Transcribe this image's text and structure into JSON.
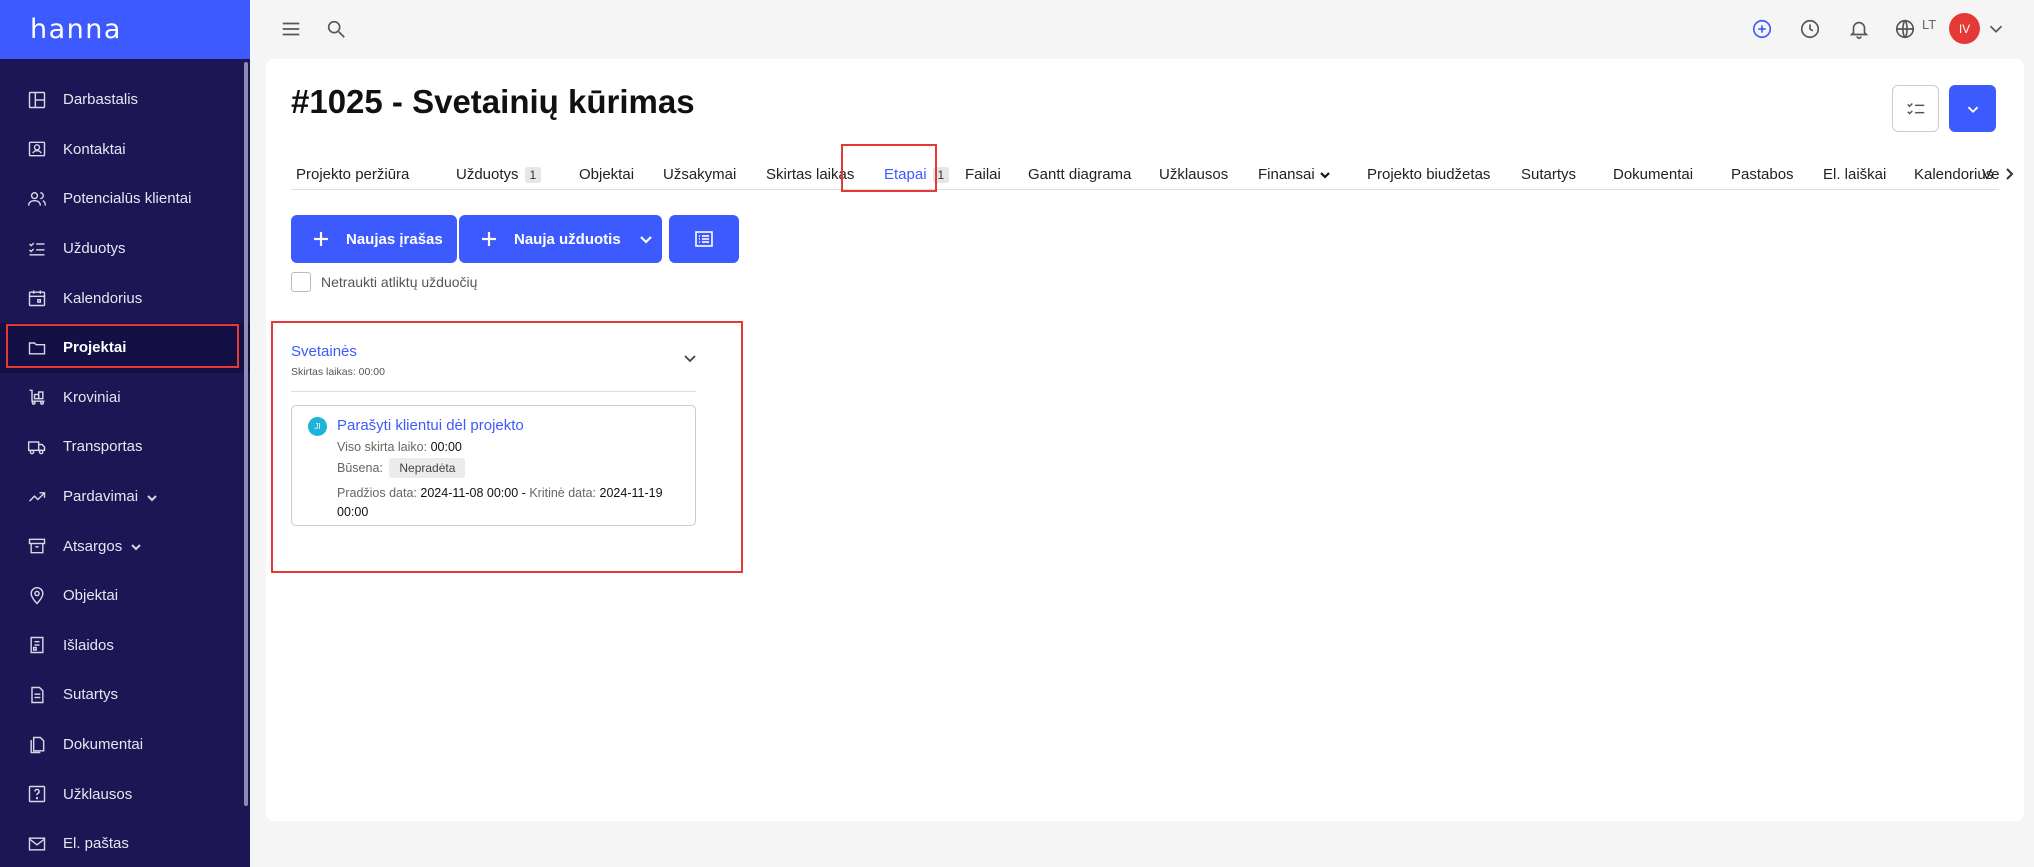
{
  "logo": "hanna",
  "sidebar": {
    "items": [
      {
        "label": "Darbastalis",
        "icon": "dashboard-icon"
      },
      {
        "label": "Kontaktai",
        "icon": "contacts-icon"
      },
      {
        "label": "Potencialūs klientai",
        "icon": "leads-icon"
      },
      {
        "label": "Užduotys",
        "icon": "tasks-icon"
      },
      {
        "label": "Kalendorius",
        "icon": "calendar-icon"
      },
      {
        "label": "Projektai",
        "icon": "folder-icon"
      },
      {
        "label": "Kroviniai",
        "icon": "cargo-icon"
      },
      {
        "label": "Transportas",
        "icon": "truck-icon"
      },
      {
        "label": "Pardavimai",
        "icon": "trending-icon"
      },
      {
        "label": "Atsargos",
        "icon": "archive-icon"
      },
      {
        "label": "Objektai",
        "icon": "location-icon"
      },
      {
        "label": "Išlaidos",
        "icon": "receipt-icon"
      },
      {
        "label": "Sutartys",
        "icon": "contract-icon"
      },
      {
        "label": "Dokumentai",
        "icon": "documents-icon"
      },
      {
        "label": "Užklausos",
        "icon": "question-icon"
      },
      {
        "label": "El. paštas",
        "icon": "mail-icon"
      }
    ],
    "active": "Projektai"
  },
  "topbar": {
    "language": "LT",
    "user_initials": "IV"
  },
  "page": {
    "title": "#1025 - Svetainių kūrimas"
  },
  "tabs": [
    {
      "label": "Projekto peržiūra"
    },
    {
      "label": "Užduotys",
      "badge": "1"
    },
    {
      "label": "Objektai"
    },
    {
      "label": "Užsakymai"
    },
    {
      "label": "Skirtas laikas"
    },
    {
      "label": "Etapai",
      "badge": "1",
      "active": true
    },
    {
      "label": "Failai"
    },
    {
      "label": "Gantt diagrama"
    },
    {
      "label": "Užklausos"
    },
    {
      "label": "Finansai"
    },
    {
      "label": "Projekto biudžetas"
    },
    {
      "label": "Sutartys"
    },
    {
      "label": "Dokumentai"
    },
    {
      "label": "Pastabos"
    },
    {
      "label": "El. laiškai"
    },
    {
      "label": "Kalendorius"
    },
    {
      "label": "Ve"
    }
  ],
  "actions": {
    "new_record": "Naujas įrašas",
    "new_task": "Nauja užduotis",
    "exclude_done": "Netraukti atliktų užduočių"
  },
  "stage": {
    "title": "Svetainės",
    "subtitle": "Skirtas laikas: 00:00",
    "task": {
      "avatar": "JI",
      "title": "Parašyti klientui dėl projekto",
      "total_label": "Viso skirta laiko:",
      "total_value": "00:00",
      "status_label": "Būsena:",
      "status_value": "Nepradėta",
      "start_label": "Pradžios data:",
      "start_value": "2024-11-08 00:00",
      "dash": "-",
      "due_label": "Kritinė data:",
      "due_value": "2024-11-19",
      "due_time": "00:00"
    }
  }
}
